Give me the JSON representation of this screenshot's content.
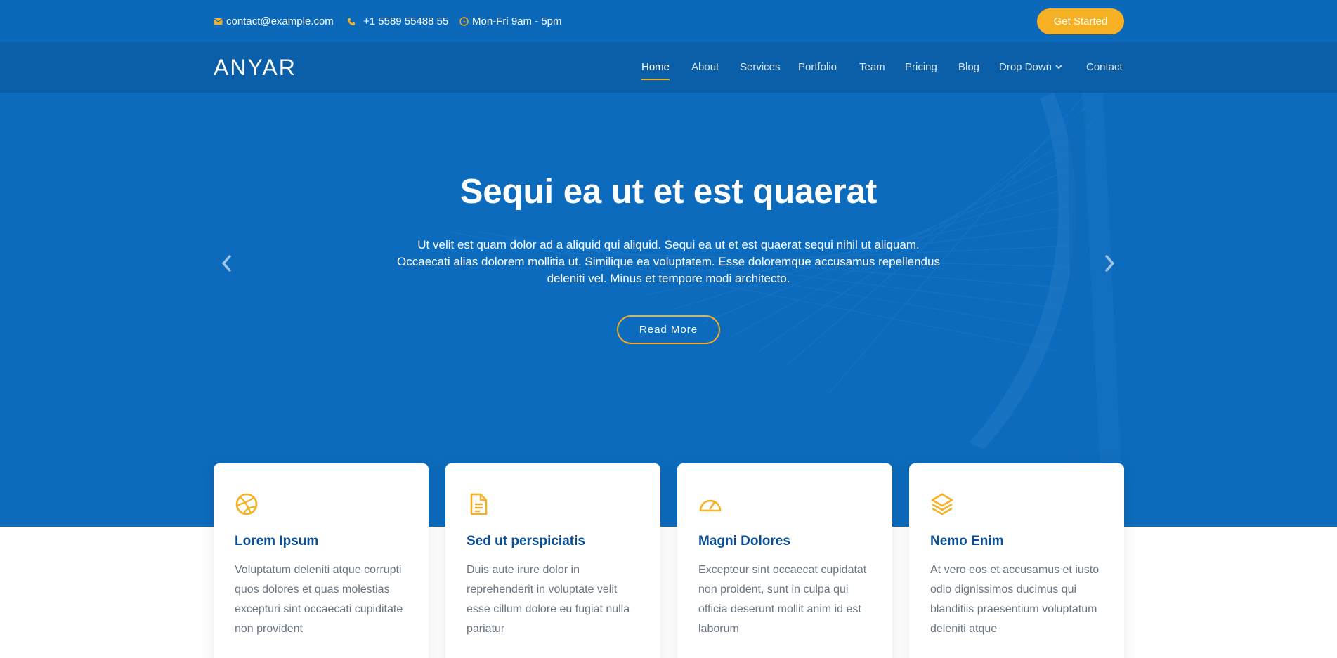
{
  "topbar": {
    "email": "contact@example.com",
    "phone": "+1 5589 55488 55",
    "hours": "Mon-Fri 9am - 5pm",
    "cta_label": "Get Started"
  },
  "nav": {
    "logo": "ANYAR",
    "items": [
      "Home",
      "About",
      "Services",
      "Portfolio",
      "Team",
      "Pricing",
      "Blog",
      "Drop Down",
      "Contact"
    ],
    "active": "Home"
  },
  "hero": {
    "title": "Sequi ea ut et est quaerat",
    "text": "Ut velit est quam dolor ad a aliquid qui aliquid. Sequi ea ut et est quaerat sequi nihil ut aliquam. Occaecati alias dolorem mollitia ut. Similique ea voluptatem. Esse doloremque accusamus repellendus deleniti vel. Minus et tempore modi architecto.",
    "button_label": "Read More"
  },
  "cards": [
    {
      "icon": "dribbble-icon",
      "title": "Lorem Ipsum",
      "text": "Voluptatum deleniti atque corrupti quos dolores et quas molestias excepturi sint occaecati cupiditate non provident"
    },
    {
      "icon": "file-icon",
      "title": "Sed ut perspiciatis",
      "text": "Duis aute irure dolor in reprehenderit in voluptate velit esse cillum dolore eu fugiat nulla pariatur"
    },
    {
      "icon": "speedometer-icon",
      "title": "Magni Dolores",
      "text": "Excepteur sint occaecat cupidatat non proident, sunt in culpa qui officia deserunt mollit anim id est laborum"
    },
    {
      "icon": "layers-icon",
      "title": "Nemo Enim",
      "text": "At vero eos et accusamus et iusto odio dignissimos ducimus qui blanditiis praesentium voluptatum deleniti atque"
    }
  ],
  "colors": {
    "primary": "#0d6bbd",
    "nav_bg": "#0a5fa8",
    "accent": "#f6b024",
    "card_title": "#0a4f94",
    "card_text": "#6a7580"
  }
}
